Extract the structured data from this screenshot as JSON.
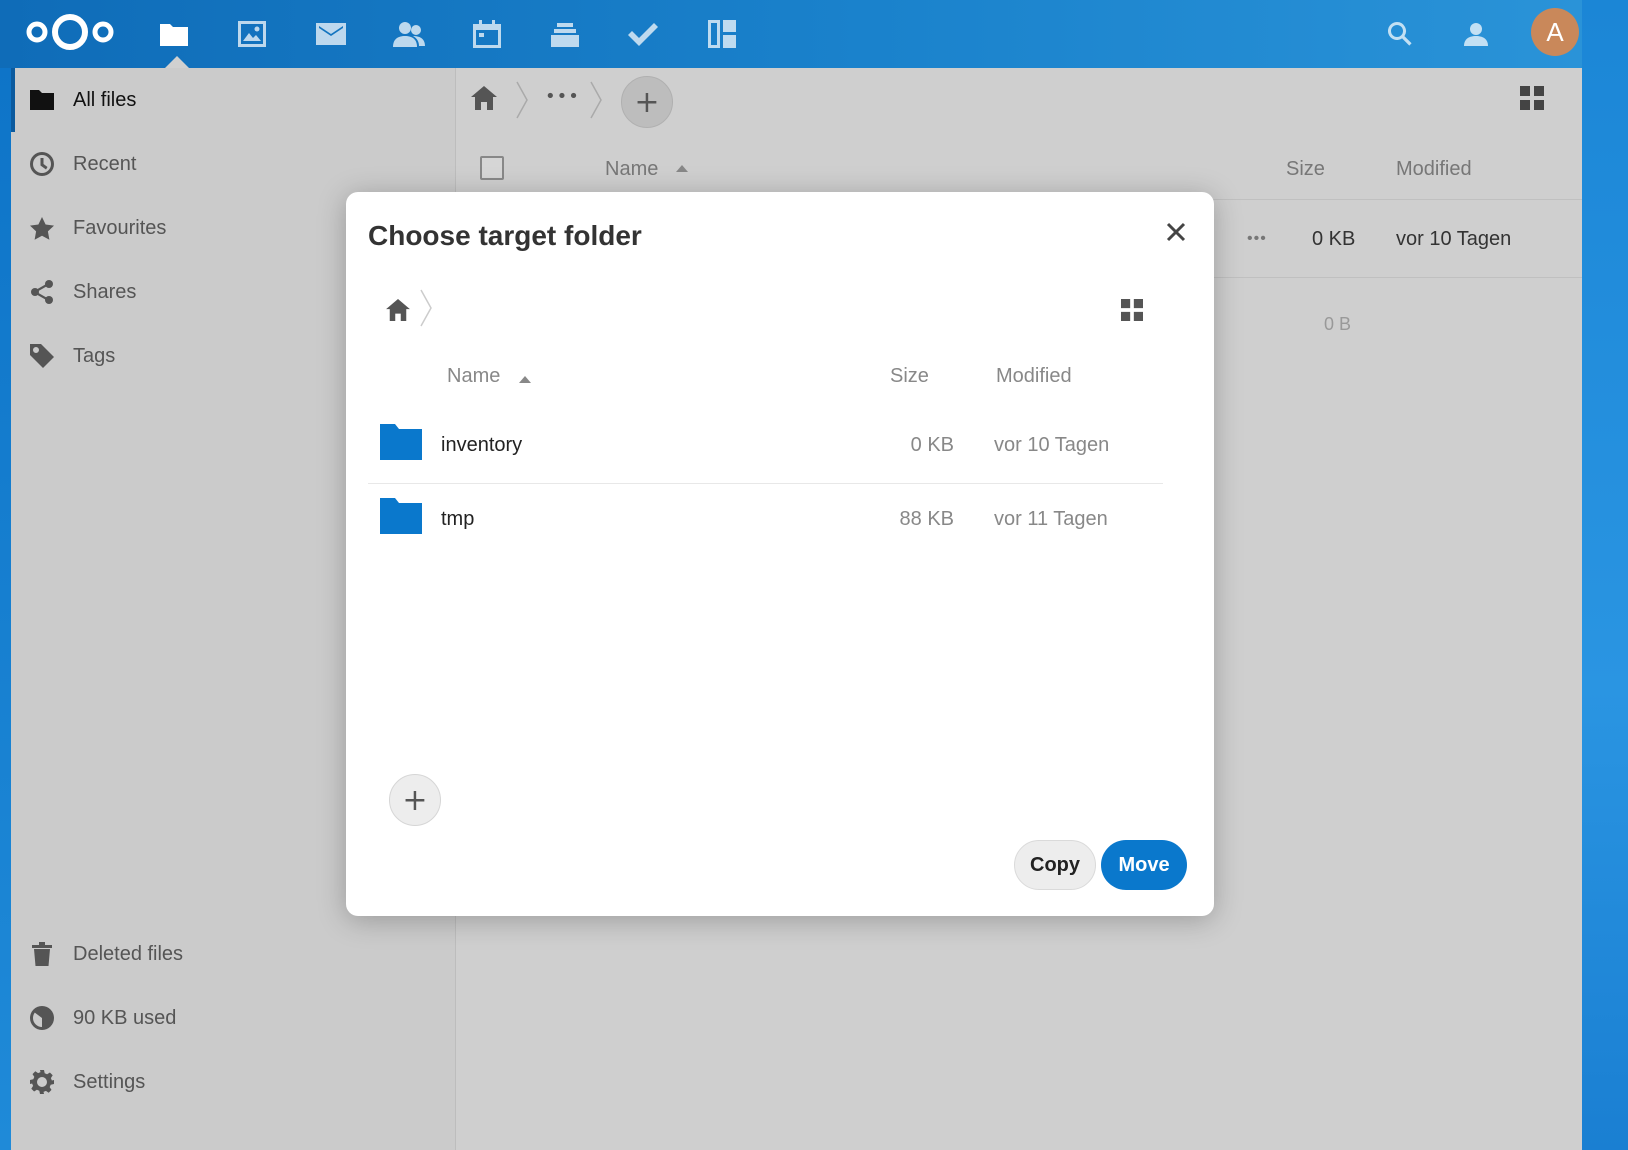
{
  "header": {
    "apps": [
      {
        "name": "files-icon",
        "active": true
      },
      {
        "name": "photos-icon"
      },
      {
        "name": "mail-icon"
      },
      {
        "name": "contacts-icon"
      },
      {
        "name": "calendar-icon"
      },
      {
        "name": "deck-icon"
      },
      {
        "name": "tasks-icon"
      },
      {
        "name": "dashboard-icon"
      }
    ],
    "avatar_letter": "A",
    "avatar_color": "#c9885a",
    "brand_color": "#0a78cc"
  },
  "sidebar": {
    "items": [
      {
        "label": "All files",
        "icon": "folder-icon"
      },
      {
        "label": "Recent",
        "icon": "clock-icon"
      },
      {
        "label": "Favourites",
        "icon": "star-icon"
      },
      {
        "label": "Shares",
        "icon": "share-icon"
      },
      {
        "label": "Tags",
        "icon": "tag-icon"
      }
    ],
    "bottom": [
      {
        "label": "Deleted files",
        "icon": "trash-icon"
      },
      {
        "label": "90 KB used",
        "icon": "quota-icon"
      },
      {
        "label": "Settings",
        "icon": "gear-icon"
      }
    ]
  },
  "main": {
    "breadcrumb_more": "•••",
    "columns": {
      "name": "Name",
      "size": "Size",
      "modified": "Modified"
    },
    "row": {
      "more": "•••",
      "size": "0 KB",
      "modified": "vor 10 Tagen"
    },
    "total_size": "0 B"
  },
  "modal": {
    "title": "Choose target folder",
    "columns": {
      "name": "Name",
      "size": "Size",
      "modified": "Modified"
    },
    "files": [
      {
        "name": "inventory",
        "size": "0 KB",
        "modified": "vor 10 Tagen"
      },
      {
        "name": "tmp",
        "size": "88 KB",
        "modified": "vor 11 Tagen"
      }
    ],
    "copy_label": "Copy",
    "move_label": "Move",
    "add_label": "+"
  }
}
